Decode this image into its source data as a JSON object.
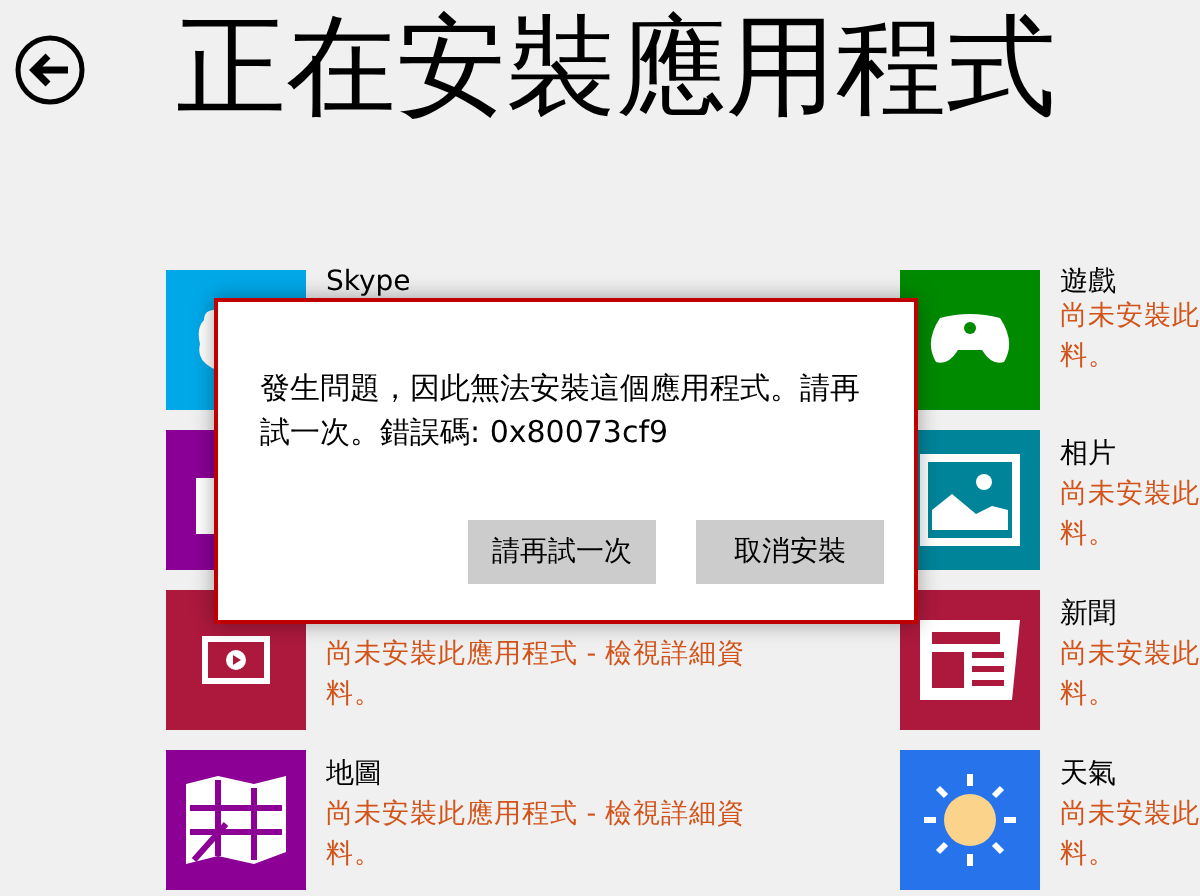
{
  "title": "正在安裝應用程式",
  "apps_left": [
    {
      "name": "Skype",
      "color": "#00a8e8"
    },
    {
      "color": "#8a0096"
    },
    {
      "color": "#ac193d",
      "status_lines": [
        "尚未安裝此應用程式 - 檢視詳細資",
        "料。"
      ]
    },
    {
      "name": "地圖",
      "color": "#8c0095",
      "status_lines": [
        "尚未安裝此應用程式 - 檢視詳細資",
        "料。"
      ]
    }
  ],
  "apps_right": [
    {
      "name": "遊戲",
      "color": "#008a00",
      "status_lines": [
        "尚未安裝此",
        "料。"
      ]
    },
    {
      "name": "相片",
      "color": "#00849a",
      "status_lines": [
        "尚未安裝此",
        "料。"
      ]
    },
    {
      "name": "新聞",
      "color": "#ac193d",
      "status_lines": [
        "尚未安裝此",
        "料。"
      ]
    },
    {
      "name": "天氣",
      "color": "#2673ec",
      "status_lines": [
        "尚未安裝此",
        "料。"
      ]
    }
  ],
  "dialog": {
    "message": "發生問題，因此無法安裝這個應用程式。請再試一次。錯誤碼: 0x80073cf9",
    "buttons": [
      "請再試一次",
      "取消安裝"
    ]
  }
}
